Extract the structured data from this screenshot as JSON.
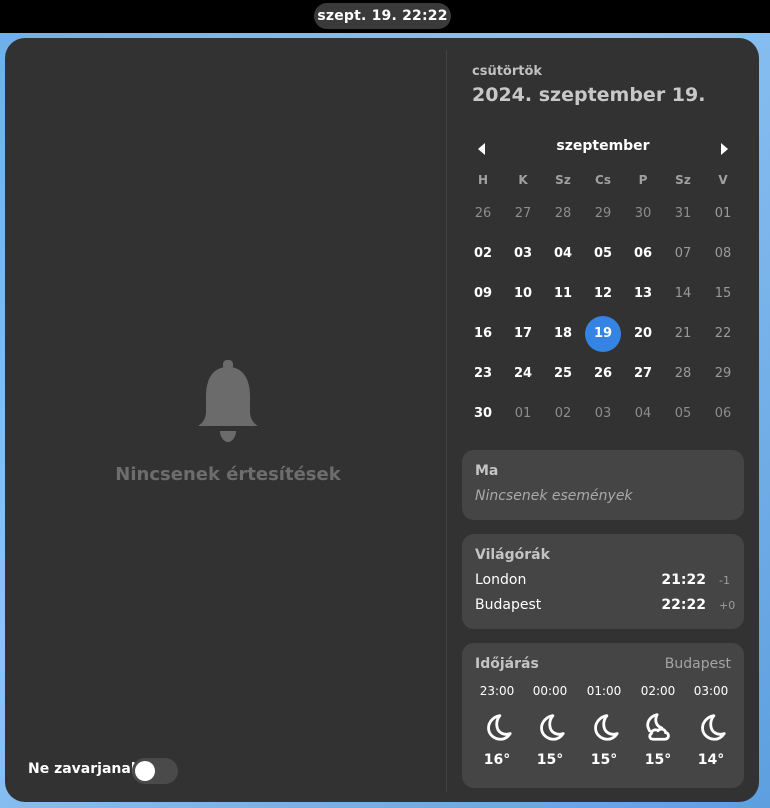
{
  "topbar": {
    "clock": "szept. 19.  22:22"
  },
  "notifications": {
    "empty_label": "Nincsenek értesítések",
    "dnd_label": "Ne zavarjanak",
    "dnd_on": false
  },
  "calendar": {
    "weekday": "csütörtök",
    "full_date": "2024. szeptember 19.",
    "month": "szeptember",
    "day_headers": [
      "H",
      "K",
      "Sz",
      "Cs",
      "P",
      "Sz",
      "V"
    ],
    "weeks": [
      [
        "26",
        "27",
        "28",
        "29",
        "30",
        "31",
        "01"
      ],
      [
        "02",
        "03",
        "04",
        "05",
        "06",
        "07",
        "08"
      ],
      [
        "09",
        "10",
        "11",
        "12",
        "13",
        "14",
        "15"
      ],
      [
        "16",
        "17",
        "18",
        "19",
        "20",
        "21",
        "22"
      ],
      [
        "23",
        "24",
        "25",
        "26",
        "27",
        "28",
        "29"
      ],
      [
        "30",
        "01",
        "02",
        "03",
        "04",
        "05",
        "06"
      ]
    ],
    "today": "19"
  },
  "events": {
    "title": "Ma",
    "empty": "Nincsenek események"
  },
  "world_clocks": {
    "title": "Világórák",
    "rows": [
      {
        "city": "London",
        "time": "21:22",
        "offset": "-1"
      },
      {
        "city": "Budapest",
        "time": "22:22",
        "offset": "+0"
      }
    ]
  },
  "weather": {
    "title": "Időjárás",
    "location": "Budapest",
    "forecast": [
      {
        "time": "23:00",
        "icon": "moon-icon",
        "temp": "16°"
      },
      {
        "time": "00:00",
        "icon": "moon-icon",
        "temp": "15°"
      },
      {
        "time": "01:00",
        "icon": "moon-icon",
        "temp": "15°"
      },
      {
        "time": "02:00",
        "icon": "moon-cloud-icon",
        "temp": "15°"
      },
      {
        "time": "03:00",
        "icon": "moon-icon",
        "temp": "14°"
      }
    ]
  },
  "colors": {
    "accent": "#3584e4",
    "panel": "#323232",
    "card": "#454545"
  }
}
